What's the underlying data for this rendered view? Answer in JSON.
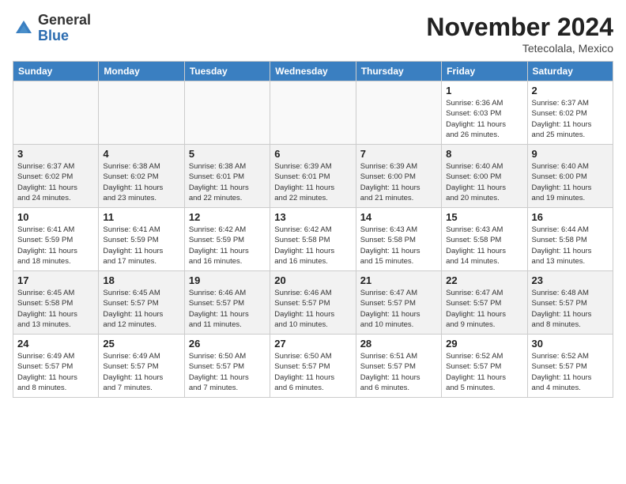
{
  "header": {
    "logo": {
      "general": "General",
      "blue": "Blue"
    },
    "title": "November 2024",
    "subtitle": "Tetecolala, Mexico"
  },
  "weekdays": [
    "Sunday",
    "Monday",
    "Tuesday",
    "Wednesday",
    "Thursday",
    "Friday",
    "Saturday"
  ],
  "weeks": [
    [
      {
        "day": "",
        "info": "",
        "empty": true
      },
      {
        "day": "",
        "info": "",
        "empty": true
      },
      {
        "day": "",
        "info": "",
        "empty": true
      },
      {
        "day": "",
        "info": "",
        "empty": true
      },
      {
        "day": "",
        "info": "",
        "empty": true
      },
      {
        "day": "1",
        "info": "Sunrise: 6:36 AM\nSunset: 6:03 PM\nDaylight: 11 hours\nand 26 minutes.",
        "empty": false
      },
      {
        "day": "2",
        "info": "Sunrise: 6:37 AM\nSunset: 6:02 PM\nDaylight: 11 hours\nand 25 minutes.",
        "empty": false
      }
    ],
    [
      {
        "day": "3",
        "info": "Sunrise: 6:37 AM\nSunset: 6:02 PM\nDaylight: 11 hours\nand 24 minutes.",
        "empty": false
      },
      {
        "day": "4",
        "info": "Sunrise: 6:38 AM\nSunset: 6:02 PM\nDaylight: 11 hours\nand 23 minutes.",
        "empty": false
      },
      {
        "day": "5",
        "info": "Sunrise: 6:38 AM\nSunset: 6:01 PM\nDaylight: 11 hours\nand 22 minutes.",
        "empty": false
      },
      {
        "day": "6",
        "info": "Sunrise: 6:39 AM\nSunset: 6:01 PM\nDaylight: 11 hours\nand 22 minutes.",
        "empty": false
      },
      {
        "day": "7",
        "info": "Sunrise: 6:39 AM\nSunset: 6:00 PM\nDaylight: 11 hours\nand 21 minutes.",
        "empty": false
      },
      {
        "day": "8",
        "info": "Sunrise: 6:40 AM\nSunset: 6:00 PM\nDaylight: 11 hours\nand 20 minutes.",
        "empty": false
      },
      {
        "day": "9",
        "info": "Sunrise: 6:40 AM\nSunset: 6:00 PM\nDaylight: 11 hours\nand 19 minutes.",
        "empty": false
      }
    ],
    [
      {
        "day": "10",
        "info": "Sunrise: 6:41 AM\nSunset: 5:59 PM\nDaylight: 11 hours\nand 18 minutes.",
        "empty": false
      },
      {
        "day": "11",
        "info": "Sunrise: 6:41 AM\nSunset: 5:59 PM\nDaylight: 11 hours\nand 17 minutes.",
        "empty": false
      },
      {
        "day": "12",
        "info": "Sunrise: 6:42 AM\nSunset: 5:59 PM\nDaylight: 11 hours\nand 16 minutes.",
        "empty": false
      },
      {
        "day": "13",
        "info": "Sunrise: 6:42 AM\nSunset: 5:58 PM\nDaylight: 11 hours\nand 16 minutes.",
        "empty": false
      },
      {
        "day": "14",
        "info": "Sunrise: 6:43 AM\nSunset: 5:58 PM\nDaylight: 11 hours\nand 15 minutes.",
        "empty": false
      },
      {
        "day": "15",
        "info": "Sunrise: 6:43 AM\nSunset: 5:58 PM\nDaylight: 11 hours\nand 14 minutes.",
        "empty": false
      },
      {
        "day": "16",
        "info": "Sunrise: 6:44 AM\nSunset: 5:58 PM\nDaylight: 11 hours\nand 13 minutes.",
        "empty": false
      }
    ],
    [
      {
        "day": "17",
        "info": "Sunrise: 6:45 AM\nSunset: 5:58 PM\nDaylight: 11 hours\nand 13 minutes.",
        "empty": false
      },
      {
        "day": "18",
        "info": "Sunrise: 6:45 AM\nSunset: 5:57 PM\nDaylight: 11 hours\nand 12 minutes.",
        "empty": false
      },
      {
        "day": "19",
        "info": "Sunrise: 6:46 AM\nSunset: 5:57 PM\nDaylight: 11 hours\nand 11 minutes.",
        "empty": false
      },
      {
        "day": "20",
        "info": "Sunrise: 6:46 AM\nSunset: 5:57 PM\nDaylight: 11 hours\nand 10 minutes.",
        "empty": false
      },
      {
        "day": "21",
        "info": "Sunrise: 6:47 AM\nSunset: 5:57 PM\nDaylight: 11 hours\nand 10 minutes.",
        "empty": false
      },
      {
        "day": "22",
        "info": "Sunrise: 6:47 AM\nSunset: 5:57 PM\nDaylight: 11 hours\nand 9 minutes.",
        "empty": false
      },
      {
        "day": "23",
        "info": "Sunrise: 6:48 AM\nSunset: 5:57 PM\nDaylight: 11 hours\nand 8 minutes.",
        "empty": false
      }
    ],
    [
      {
        "day": "24",
        "info": "Sunrise: 6:49 AM\nSunset: 5:57 PM\nDaylight: 11 hours\nand 8 minutes.",
        "empty": false
      },
      {
        "day": "25",
        "info": "Sunrise: 6:49 AM\nSunset: 5:57 PM\nDaylight: 11 hours\nand 7 minutes.",
        "empty": false
      },
      {
        "day": "26",
        "info": "Sunrise: 6:50 AM\nSunset: 5:57 PM\nDaylight: 11 hours\nand 7 minutes.",
        "empty": false
      },
      {
        "day": "27",
        "info": "Sunrise: 6:50 AM\nSunset: 5:57 PM\nDaylight: 11 hours\nand 6 minutes.",
        "empty": false
      },
      {
        "day": "28",
        "info": "Sunrise: 6:51 AM\nSunset: 5:57 PM\nDaylight: 11 hours\nand 6 minutes.",
        "empty": false
      },
      {
        "day": "29",
        "info": "Sunrise: 6:52 AM\nSunset: 5:57 PM\nDaylight: 11 hours\nand 5 minutes.",
        "empty": false
      },
      {
        "day": "30",
        "info": "Sunrise: 6:52 AM\nSunset: 5:57 PM\nDaylight: 11 hours\nand 4 minutes.",
        "empty": false
      }
    ]
  ]
}
